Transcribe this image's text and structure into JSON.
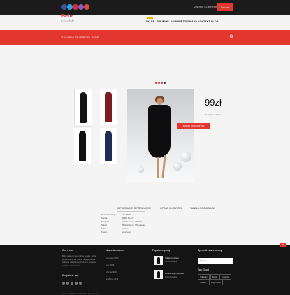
{
  "topbar": {
    "social_icons": [
      "facebook-icon",
      "twitter-icon",
      "pinterest-icon",
      "instagram-icon",
      "google-plus-icon"
    ],
    "links": "Zaloguj | Zarejestruj",
    "search_label": "Szukaj"
  },
  "brand": {
    "logo_word": "Bebe",
    "logo_sub": "my style"
  },
  "nav": {
    "items": [
      "SKLEP",
      "SUKIENKI",
      "KOMBINEZONY",
      "MAMA",
      "KONTAKT",
      "BLOG"
    ]
  },
  "banner": {
    "title": "ZAKUP W SKLEPIE PL BEBE"
  },
  "product": {
    "price": "99zł",
    "availability": "Dostępna od ręki",
    "buy_label": "DODAJ DO KOSZYKA",
    "thumb_colors": [
      "#141414",
      "#7d1d22",
      "#111111",
      "#1d2d55"
    ]
  },
  "tabs": [
    "INFORMACJE O PRODUKCIE",
    "OPINIE KLIENTÓW",
    "TABELA ROZMIARÓW"
  ],
  "specs": [
    {
      "label": "Numer katalogu",
      "value": "10.100093"
    },
    {
      "label": "Marka",
      "value": "BEBE PL/NY"
    },
    {
      "label": "Długość",
      "value": "midi do kolan, 98/100"
    },
    {
      "label": "Skład",
      "value": "95% wiskoza, 5% elastan"
    },
    {
      "label": "Kolor",
      "value": "czarny"
    },
    {
      "label": "Fason",
      "value": "kopertowy"
    }
  ],
  "footer": {
    "about_title": "Coś o nas",
    "about_text": [
      "Bebe sukienki jest marką polską, od lat",
      "dostarczamy dla Ciebie najpiękniejsze",
      "sukienki z wyjątkowych tkanin, szyte w",
      "polskich szwalniach."
    ],
    "find_title": "Znajdziesz nas",
    "archive_title": "Nasze Archiwum",
    "archive": [
      "Czerwiec 2015",
      "Luty 2015",
      "Styczeń 2015",
      "Grudzień 2014"
    ],
    "popular_title": "Popularne posty",
    "posts": [
      {
        "title": "Sukienki na lato",
        "meta": "0 Komentarzy"
      },
      {
        "title": "Modne w tym sezonie",
        "meta": "0 Komentarzy"
      }
    ],
    "search_title": "Sprawdź nasze strony",
    "search_placeholder": "Szukaj...",
    "tags_title": "Tag Cloud",
    "tags": [
      "Sukienki",
      "Moda",
      "Kolekcja",
      "Trendy",
      "Wyprzedaż"
    ],
    "bottom_links": "Home   Sklep   Kontakt   Polityka prywatności"
  }
}
